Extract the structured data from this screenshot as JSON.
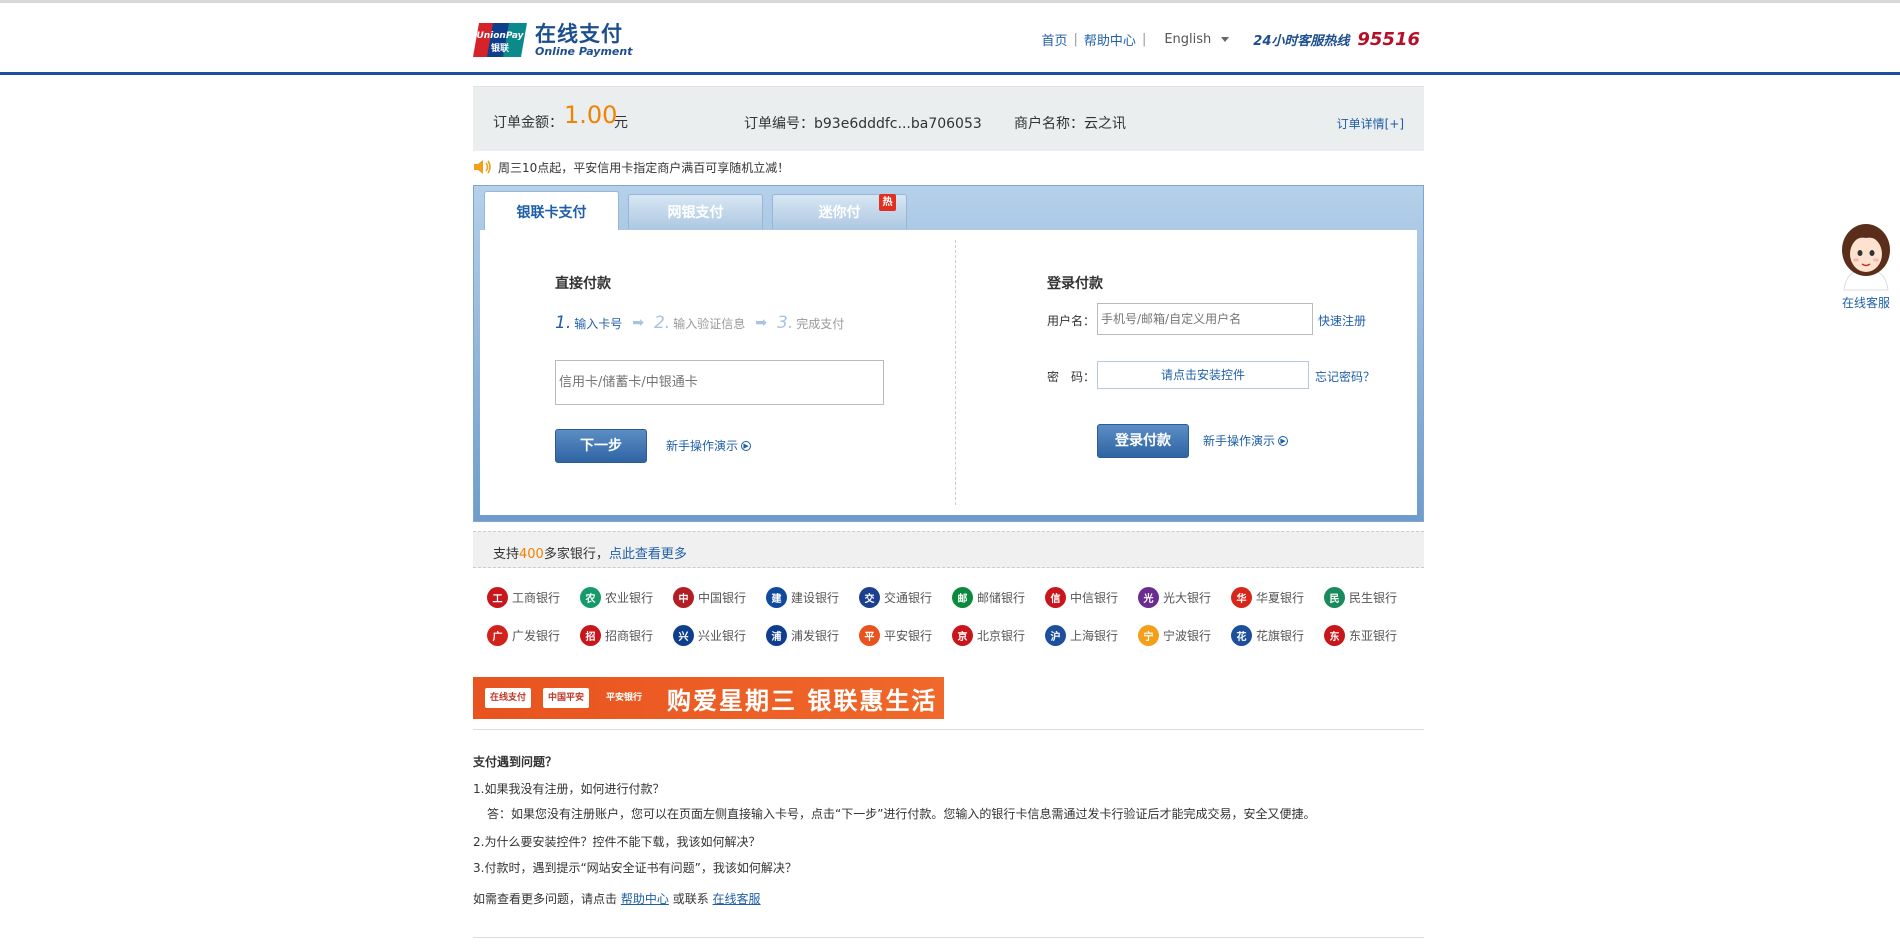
{
  "header": {
    "logo_cn": "在线支付",
    "logo_en": "Online Payment",
    "logo_mark_top": "UnionPay",
    "logo_mark_bottom": "银联",
    "nav": [
      "首页",
      "帮助中心"
    ],
    "language": "English",
    "hotline_label": "24小时客服热线",
    "hotline_number": "95516"
  },
  "order": {
    "amount_label": "订单金额：",
    "amount_value": "1.00",
    "amount_unit": "元",
    "order_no": "订单编号：b93e6dddfc...ba706053",
    "merchant": "商户名称：云之讯",
    "detail_link": "订单详情[+]"
  },
  "notice": "周三10点起，平安信用卡指定商户满百可享随机立减！",
  "tabs": [
    {
      "label": "银联卡支付",
      "active": true
    },
    {
      "label": "网银支付",
      "active": false
    },
    {
      "label": "迷你付",
      "active": false,
      "badge": "热"
    }
  ],
  "direct": {
    "title": "直接付款",
    "steps": [
      {
        "num": "1.",
        "label": "输入卡号"
      },
      {
        "num": "2.",
        "label": "输入验证信息"
      },
      {
        "num": "3.",
        "label": "完成支付"
      }
    ],
    "card_placeholder": "信用卡/储蓄卡/中银通卡",
    "next_button": "下一步",
    "demo_link": "新手操作演示"
  },
  "login": {
    "title": "登录付款",
    "username_label": "用户名：",
    "username_placeholder": "手机号/邮箱/自定义用户名",
    "register_link": "快速注册",
    "password_label": "密　码：",
    "install_control": "请点击安装控件",
    "forgot_link": "忘记密码？",
    "login_button": "登录付款",
    "demo_link": "新手操作演示"
  },
  "banks_bar": {
    "prefix": "支持",
    "count": "400",
    "suffix": "多家银行，",
    "more_link": "点此查看更多"
  },
  "banks": [
    {
      "name": "工商银行",
      "color": "#c8161d",
      "glyph": "工"
    },
    {
      "name": "农业银行",
      "color": "#159b6a",
      "glyph": "农"
    },
    {
      "name": "中国银行",
      "color": "#b21e23",
      "glyph": "中"
    },
    {
      "name": "建设银行",
      "color": "#0f4a9c",
      "glyph": "建"
    },
    {
      "name": "交通银行",
      "color": "#1d3f8f",
      "glyph": "交"
    },
    {
      "name": "邮储银行",
      "color": "#0b8a3e",
      "glyph": "邮"
    },
    {
      "name": "中信银行",
      "color": "#c8161d",
      "glyph": "信"
    },
    {
      "name": "光大银行",
      "color": "#6a2c8f",
      "glyph": "光"
    },
    {
      "name": "华夏银行",
      "color": "#d7261a",
      "glyph": "华"
    },
    {
      "name": "民生银行",
      "color": "#1a8a5e",
      "glyph": "民"
    },
    {
      "name": "广发银行",
      "color": "#d1231b",
      "glyph": "广"
    },
    {
      "name": "招商银行",
      "color": "#c8161d",
      "glyph": "招"
    },
    {
      "name": "兴业银行",
      "color": "#0f3f8c",
      "glyph": "兴"
    },
    {
      "name": "浦发银行",
      "color": "#103e8e",
      "glyph": "浦"
    },
    {
      "name": "平安银行",
      "color": "#e8531f",
      "glyph": "平"
    },
    {
      "name": "北京银行",
      "color": "#c8161d",
      "glyph": "京"
    },
    {
      "name": "上海银行",
      "color": "#1d4f9c",
      "glyph": "沪"
    },
    {
      "name": "宁波银行",
      "color": "#f2a01b",
      "glyph": "宁"
    },
    {
      "name": "花旗银行",
      "color": "#1d4f9c",
      "glyph": "花"
    },
    {
      "name": "东亚银行",
      "color": "#c8161d",
      "glyph": "东"
    }
  ],
  "promo": {
    "brand1": "在线支付",
    "brand2": "中国平安",
    "brand3": "平安银行",
    "slogan": "购爱星期三 银联惠生活"
  },
  "faq": {
    "title": "支付遇到问题？",
    "q1": "1.如果我没有注册，如何进行付款？",
    "a1": "答：如果您没有注册账户，您可以在页面左侧直接输入卡号，点击“下一步”进行付款。您输入的银行卡信息需通过发卡行验证后才能完成交易，安全又便捷。",
    "q2": "2.为什么要安装控件？控件不能下载，我该如何解决？",
    "q3": "3.付款时，遇到提示“网站安全证书有问题”，我该如何解决？",
    "more_prefix": "如需查看更多问题，请点击",
    "help_link": "帮助中心",
    "or_text": "或联系",
    "service_link": "在线客服"
  },
  "service": {
    "label": "在线客服"
  }
}
